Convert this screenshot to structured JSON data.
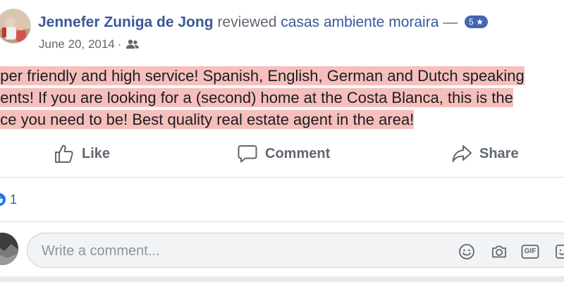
{
  "review": {
    "author": "Jennefer Zuniga de Jong",
    "verb": "reviewed",
    "page_name": "casas ambiente moraira",
    "dash": "—",
    "rating": "5",
    "rating_star": "★",
    "date": "June 20, 2014",
    "separator": "·",
    "audience_icon": "friends-icon",
    "text_lines": [
      "uper friendly and high service! Spanish, English, German and Dutch speaking",
      "gents! If you are looking for a (second) home at the Costa Blanca, this is the",
      "ace you need to be! Best quality real estate agent in the area!"
    ]
  },
  "actions": {
    "like": "Like",
    "comment": "Comment",
    "share": "Share"
  },
  "reactions": {
    "like_count": "1"
  },
  "comment_box": {
    "placeholder": "Write a comment...",
    "gif_label": "GIF"
  },
  "colors": {
    "link_blue": "#385898",
    "grey_text": "#606770",
    "highlight": "#f6bfbc",
    "badge_blue": "#4267b2"
  }
}
